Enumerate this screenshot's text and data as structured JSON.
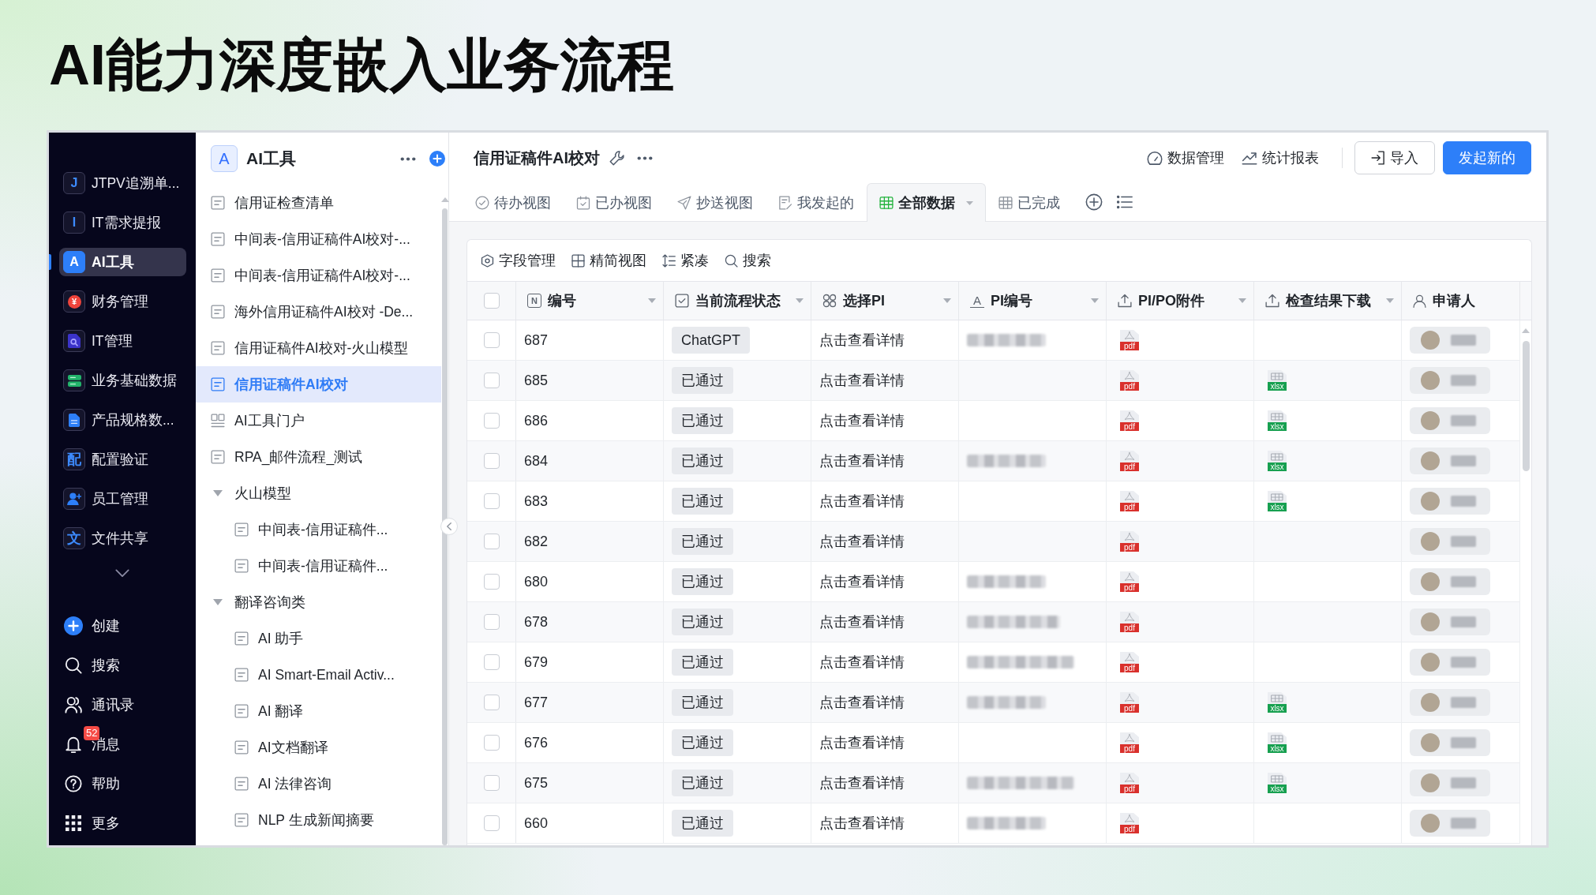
{
  "slide_title": "AI能力深度嵌入业务流程",
  "nav": {
    "items": [
      {
        "label": "JTPV追溯单...",
        "kind": "letter",
        "glyph": "J",
        "selected": false
      },
      {
        "label": "IT需求提报",
        "kind": "letter",
        "glyph": "I",
        "selected": false
      },
      {
        "label": "AI工具",
        "kind": "letter",
        "glyph": "A",
        "selected": true
      },
      {
        "label": "财务管理",
        "kind": "coin",
        "glyph": "¥",
        "selected": false
      },
      {
        "label": "IT管理",
        "kind": "doc-search",
        "selected": false
      },
      {
        "label": "业务基础数据",
        "kind": "database",
        "selected": false
      },
      {
        "label": "产品规格数...",
        "kind": "document",
        "selected": false
      },
      {
        "label": "配置验证",
        "kind": "letter",
        "glyph": "配",
        "selected": false
      },
      {
        "label": "员工管理",
        "kind": "person-add",
        "selected": false
      },
      {
        "label": "文件共享",
        "kind": "letter",
        "glyph": "文",
        "selected": false
      }
    ],
    "bottom_items": [
      {
        "label": "创建",
        "kind": "create"
      },
      {
        "label": "搜索",
        "kind": "search"
      },
      {
        "label": "通讯录",
        "kind": "contacts"
      },
      {
        "label": "消息",
        "kind": "bell",
        "badge": "52"
      },
      {
        "label": "帮助",
        "kind": "help"
      },
      {
        "label": "更多",
        "kind": "apps"
      }
    ]
  },
  "panel": {
    "glyph": "A",
    "title": "AI工具",
    "items": [
      {
        "label": "信用证检查清单",
        "kind": "sheet",
        "selected": false
      },
      {
        "label": "中间表-信用证稿件AI校对-...",
        "kind": "sheet",
        "selected": false
      },
      {
        "label": "中间表-信用证稿件AI校对-...",
        "kind": "sheet",
        "selected": false
      },
      {
        "label": "海外信用证稿件AI校对 -De...",
        "kind": "sheet",
        "selected": false
      },
      {
        "label": "信用证稿件AI校对-火山模型",
        "kind": "sheet",
        "selected": false
      },
      {
        "label": "信用证稿件AI校对",
        "kind": "sheet",
        "selected": true
      },
      {
        "label": "AI工具门户",
        "kind": "portal",
        "selected": false
      },
      {
        "label": "RPA_邮件流程_测试",
        "kind": "sheet",
        "selected": false
      },
      {
        "label": "火山模型",
        "kind": "group",
        "expanded": true,
        "children": [
          {
            "label": "中间表-信用证稿件...",
            "kind": "sheet",
            "selected": false
          },
          {
            "label": "中间表-信用证稿件...",
            "kind": "sheet",
            "selected": false
          }
        ]
      },
      {
        "label": "翻译咨询类",
        "kind": "group",
        "expanded": true,
        "children": [
          {
            "label": "AI 助手",
            "kind": "sheet",
            "selected": false
          },
          {
            "label": "AI Smart-Email Activ...",
            "kind": "sheet",
            "selected": false
          },
          {
            "label": "AI 翻译",
            "kind": "sheet",
            "selected": false
          },
          {
            "label": "AI文档翻译",
            "kind": "sheet",
            "selected": false
          },
          {
            "label": "AI 法律咨询",
            "kind": "sheet",
            "selected": false
          },
          {
            "label": "NLP 生成新闻摘要",
            "kind": "sheet",
            "selected": false
          }
        ]
      }
    ]
  },
  "main": {
    "title": "信用证稿件AI校对",
    "actions": [
      {
        "label": "数据管理",
        "kind": "gauge"
      },
      {
        "label": "统计报表",
        "kind": "trend"
      }
    ],
    "buttons": [
      {
        "label": "导入",
        "kind": "secondary"
      },
      {
        "label": "发起新的",
        "kind": "primary"
      }
    ]
  },
  "tabs": [
    {
      "label": "待办视图",
      "kind": "todo",
      "selected": false
    },
    {
      "label": "已办视图",
      "kind": "done",
      "selected": false
    },
    {
      "label": "抄送视图",
      "kind": "cc",
      "selected": false
    },
    {
      "label": "我发起的",
      "kind": "mine",
      "selected": false
    },
    {
      "label": "全部数据",
      "kind": "table",
      "selected": true
    },
    {
      "label": "已完成",
      "kind": "table",
      "selected": false
    }
  ],
  "toolbar": [
    {
      "label": "字段管理",
      "kind": "fields"
    },
    {
      "label": "精简视图",
      "kind": "compact"
    },
    {
      "label": "紧凑",
      "kind": "density"
    },
    {
      "label": "搜索",
      "kind": "search"
    }
  ],
  "table": {
    "all_selected": false,
    "columns": [
      {
        "label": "编号",
        "kind": "number",
        "glyph": "N"
      },
      {
        "label": "当前流程状态",
        "kind": "status"
      },
      {
        "label": "选择PI",
        "kind": "relation"
      },
      {
        "label": "PI编号",
        "kind": "text",
        "glyph": "A"
      },
      {
        "label": "PI/PO附件",
        "kind": "attachment"
      },
      {
        "label": "检查结果下载",
        "kind": "attachment"
      },
      {
        "label": "申请人",
        "kind": "person"
      }
    ],
    "rows": [
      {
        "selected": false,
        "number": "687",
        "status": "ChatGPT",
        "pi": "点击查看详情",
        "pi_number_blurred": true,
        "attachment": "pdf"
      },
      {
        "selected": false,
        "number": "685",
        "status": "已通过",
        "pi": "点击查看详情",
        "pi_number_blurred": false,
        "attachment": "pdf",
        "result": "xlsx"
      },
      {
        "selected": false,
        "number": "686",
        "status": "已通过",
        "pi": "点击查看详情",
        "pi_number_blurred": false,
        "attachment": "pdf",
        "result": "xlsx"
      },
      {
        "selected": false,
        "number": "684",
        "status": "已通过",
        "pi": "点击查看详情",
        "pi_number_blurred": true,
        "attachment": "pdf",
        "result": "xlsx"
      },
      {
        "selected": false,
        "number": "683",
        "status": "已通过",
        "pi": "点击查看详情",
        "pi_number_blurred": false,
        "attachment": "pdf",
        "result": "xlsx"
      },
      {
        "selected": false,
        "number": "682",
        "status": "已通过",
        "pi": "点击查看详情",
        "pi_number_blurred": false,
        "attachment": "pdf"
      },
      {
        "selected": false,
        "number": "680",
        "status": "已通过",
        "pi": "点击查看详情",
        "pi_number_blurred": true,
        "attachment": "pdf"
      },
      {
        "selected": false,
        "number": "678",
        "status": "已通过",
        "pi": "点击查看详情",
        "pi_number_blurred": true,
        "attachment": "pdf"
      },
      {
        "selected": false,
        "number": "679",
        "status": "已通过",
        "pi": "点击查看详情",
        "pi_number_blurred": true,
        "attachment": "pdf"
      },
      {
        "selected": false,
        "number": "677",
        "status": "已通过",
        "pi": "点击查看详情",
        "pi_number_blurred": true,
        "attachment": "pdf",
        "result": "xlsx"
      },
      {
        "selected": false,
        "number": "676",
        "status": "已通过",
        "pi": "点击查看详情",
        "pi_number_blurred": false,
        "attachment": "pdf",
        "result": "xlsx"
      },
      {
        "selected": false,
        "number": "675",
        "status": "已通过",
        "pi": "点击查看详情",
        "pi_number_blurred": true,
        "attachment": "pdf",
        "result": "xlsx"
      },
      {
        "selected": false,
        "number": "660",
        "status": "已通过",
        "pi": "点击查看详情",
        "pi_number_blurred": true,
        "attachment": "pdf"
      }
    ]
  }
}
